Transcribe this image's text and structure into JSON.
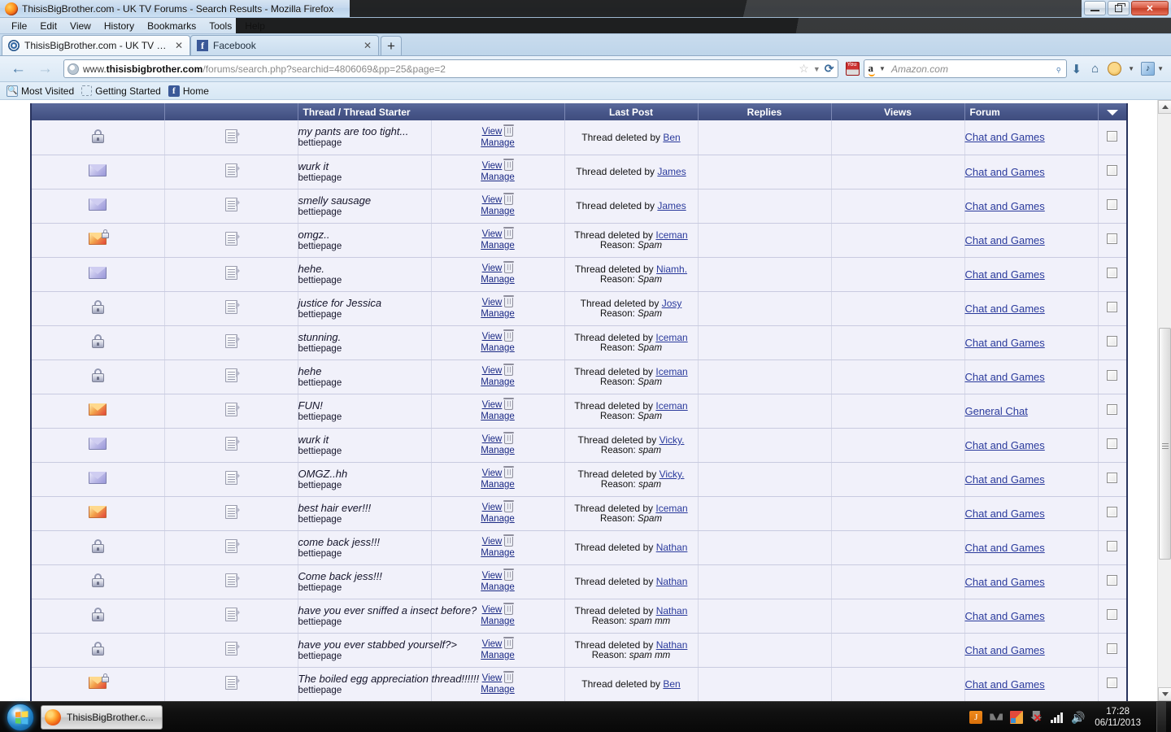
{
  "window": {
    "title": "ThisisBigBrother.com - UK TV Forums - Search Results - Mozilla Firefox",
    "minimize_label": "Minimize",
    "restore_label": "Restore",
    "close_label": "✕"
  },
  "menu": [
    "File",
    "Edit",
    "View",
    "History",
    "Bookmarks",
    "Tools",
    "Help"
  ],
  "tabs": [
    {
      "label": "ThisisBigBrother.com - UK TV Forum...",
      "close": "✕",
      "icon": "tib-favicon",
      "active": true
    },
    {
      "label": "Facebook",
      "close": "✕",
      "icon": "facebook-favicon",
      "active": false
    }
  ],
  "newtab_label": "+",
  "navigation": {
    "back": "◀",
    "forward": "▶",
    "url_prefix": "www.",
    "url_host": "thisisbigbrother.com",
    "url_path": "/forums/search.php?searchid=4806069&pp=25&page=2",
    "star": "☆",
    "chevron": "▼",
    "reload": "⟳",
    "download": "⬇",
    "home": "⌂",
    "caret": "▼"
  },
  "search": {
    "engine": "a",
    "placeholder": "Amazon.com",
    "magnifier": "⌕"
  },
  "bookmarks": [
    {
      "label": "Most Visited",
      "icon": "most-visited-icon"
    },
    {
      "label": "Getting Started",
      "icon": "getting-started-icon"
    },
    {
      "label": "Home",
      "icon": "facebook-icon"
    }
  ],
  "table": {
    "headers": {
      "status": "",
      "type": "",
      "thread": "Thread / Thread Starter",
      "view": "",
      "lastpost": "Last Post",
      "replies": "Replies",
      "views": "Views",
      "forum": "Forum",
      "filter": "▼"
    },
    "links": {
      "view": "View",
      "manage": "Manage"
    },
    "deleted_prefix": "Thread deleted by",
    "reason_label": "Reason:",
    "rows": [
      {
        "status": "lock",
        "title": "my pants are too tight...",
        "starter": "bettiepage",
        "deleted_by": "Ben",
        "reason": "",
        "forum": "Chat and Games"
      },
      {
        "status": "envelope",
        "title": "wurk it",
        "starter": "bettiepage",
        "deleted_by": "James",
        "reason": "",
        "forum": "Chat and Games"
      },
      {
        "status": "envelope",
        "title": "smelly sausage",
        "starter": "bettiepage",
        "deleted_by": "James",
        "reason": "",
        "forum": "Chat and Games"
      },
      {
        "status": "hot-lock",
        "title": "omgz..",
        "starter": "bettiepage",
        "deleted_by": "Iceman",
        "reason": "Spam",
        "forum": "Chat and Games"
      },
      {
        "status": "envelope",
        "title": "hehe.",
        "starter": "bettiepage",
        "deleted_by": "Niamh.",
        "reason": "Spam",
        "forum": "Chat and Games"
      },
      {
        "status": "lock",
        "title": "justice for Jessica",
        "starter": "bettiepage",
        "deleted_by": "Josy",
        "reason": "Spam",
        "forum": "Chat and Games"
      },
      {
        "status": "lock",
        "title": "stunning.",
        "starter": "bettiepage",
        "deleted_by": "Iceman",
        "reason": "Spam",
        "forum": "Chat and Games"
      },
      {
        "status": "lock",
        "title": "hehe",
        "starter": "bettiepage",
        "deleted_by": "Iceman",
        "reason": "Spam",
        "forum": "Chat and Games"
      },
      {
        "status": "hot",
        "title": "FUN!",
        "starter": "bettiepage",
        "deleted_by": "Iceman",
        "reason": "Spam",
        "forum": "General Chat"
      },
      {
        "status": "envelope",
        "title": "wurk it",
        "starter": "bettiepage",
        "deleted_by": "Vicky.",
        "reason": "spam",
        "forum": "Chat and Games"
      },
      {
        "status": "envelope",
        "title": "OMGZ..hh",
        "starter": "bettiepage",
        "deleted_by": "Vicky.",
        "reason": "spam",
        "forum": "Chat and Games"
      },
      {
        "status": "hot",
        "title": "best hair ever!!!",
        "starter": "bettiepage",
        "deleted_by": "Iceman",
        "reason": "Spam",
        "forum": "Chat and Games"
      },
      {
        "status": "lock",
        "title": "come back jess!!!",
        "starter": "bettiepage",
        "deleted_by": "Nathan",
        "reason": "",
        "forum": "Chat and Games"
      },
      {
        "status": "lock",
        "title": "Come back jess!!!",
        "starter": "bettiepage",
        "deleted_by": "Nathan",
        "reason": "",
        "forum": "Chat and Games"
      },
      {
        "status": "lock",
        "title": "have you ever sniffed a insect before?",
        "starter": "bettiepage",
        "deleted_by": "Nathan",
        "reason": "spam mm",
        "forum": "Chat and Games"
      },
      {
        "status": "lock",
        "title": "have you ever stabbed yourself?>",
        "starter": "bettiepage",
        "deleted_by": "Nathan",
        "reason": "spam mm",
        "forum": "Chat and Games"
      },
      {
        "status": "hot-lock",
        "title": "The boiled egg appreciation thread!!!!!!",
        "starter": "bettiepage",
        "deleted_by": "Ben",
        "reason": "",
        "forum": "Chat and Games"
      }
    ]
  },
  "taskbar": {
    "start_label": "Start",
    "buttons": [
      {
        "label": "ThisisBigBrother.c...",
        "icon": "firefox-icon"
      }
    ],
    "tray": [
      "java-icon",
      "gray-icon",
      "colors-icon",
      "network-disconnected-icon",
      "signal-icon",
      "volume-icon"
    ],
    "clock_time": "17:28",
    "clock_date": "06/11/2013"
  },
  "colors": {
    "header_blue": "#48578a",
    "row_bg": "#f1f1fa",
    "lastpost_bg": "#e2e4f0",
    "link": "#2a3a9c",
    "border": "#28335e"
  }
}
